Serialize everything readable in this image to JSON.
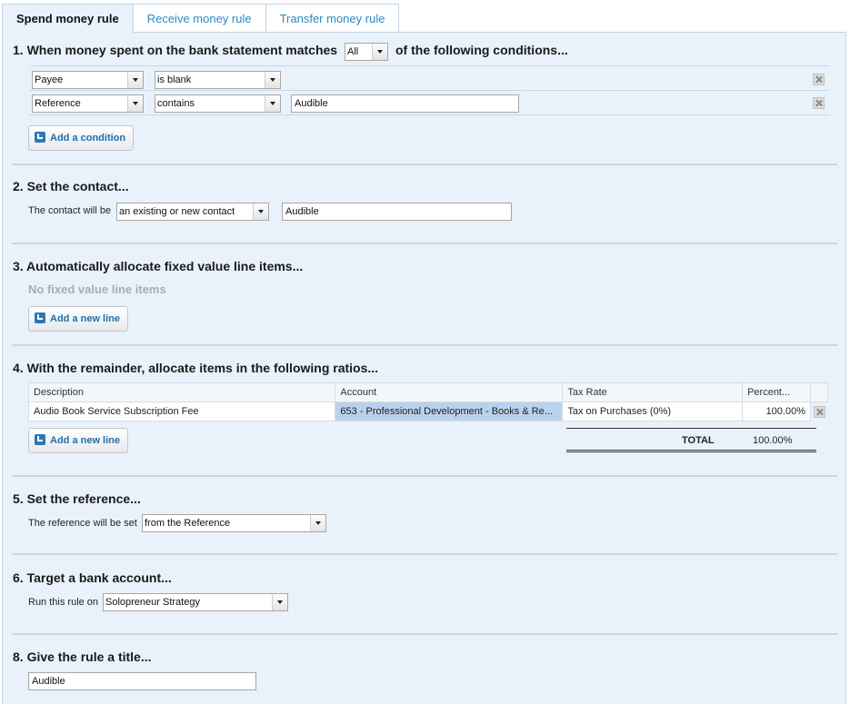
{
  "tabs": [
    "Spend money rule",
    "Receive money rule",
    "Transfer money rule"
  ],
  "section1": {
    "title_prefix": "1. When money spent on the bank statement matches",
    "match_value": "All",
    "title_suffix": "of the following conditions...",
    "conditions": [
      {
        "field": "Payee",
        "operator": "is blank",
        "value": ""
      },
      {
        "field": "Reference",
        "operator": "contains",
        "value": "Audible"
      }
    ],
    "add_condition": "Add a condition"
  },
  "section2": {
    "title": "2. Set the contact...",
    "label": "The contact will be",
    "contact_mode": "an existing or new contact",
    "contact_value": "Audible"
  },
  "section3": {
    "title": "3. Automatically allocate fixed value line items...",
    "empty_text": "No fixed value line items",
    "add_line": "Add a new line"
  },
  "section4": {
    "title": "4. With the remainder, allocate items in the following ratios...",
    "headers": [
      "Description",
      "Account",
      "Tax Rate",
      "Percent..."
    ],
    "rows": [
      {
        "description": "Audio Book Service Subscription Fee",
        "account": "653 - Professional Development - Books & Re...",
        "tax_rate": "Tax on Purchases (0%)",
        "percent": "100.00%"
      }
    ],
    "add_line": "Add a new line",
    "total_label": "TOTAL",
    "total_value": "100.00%"
  },
  "section5": {
    "title": "5. Set the reference...",
    "label": "The reference will be set",
    "reference_mode": "from the Reference"
  },
  "section6": {
    "title": "6. Target a bank account...",
    "label": "Run this rule on",
    "account": "Solopreneur Strategy"
  },
  "section8": {
    "title": "8. Give the rule a title...",
    "rule_title": "Audible"
  }
}
